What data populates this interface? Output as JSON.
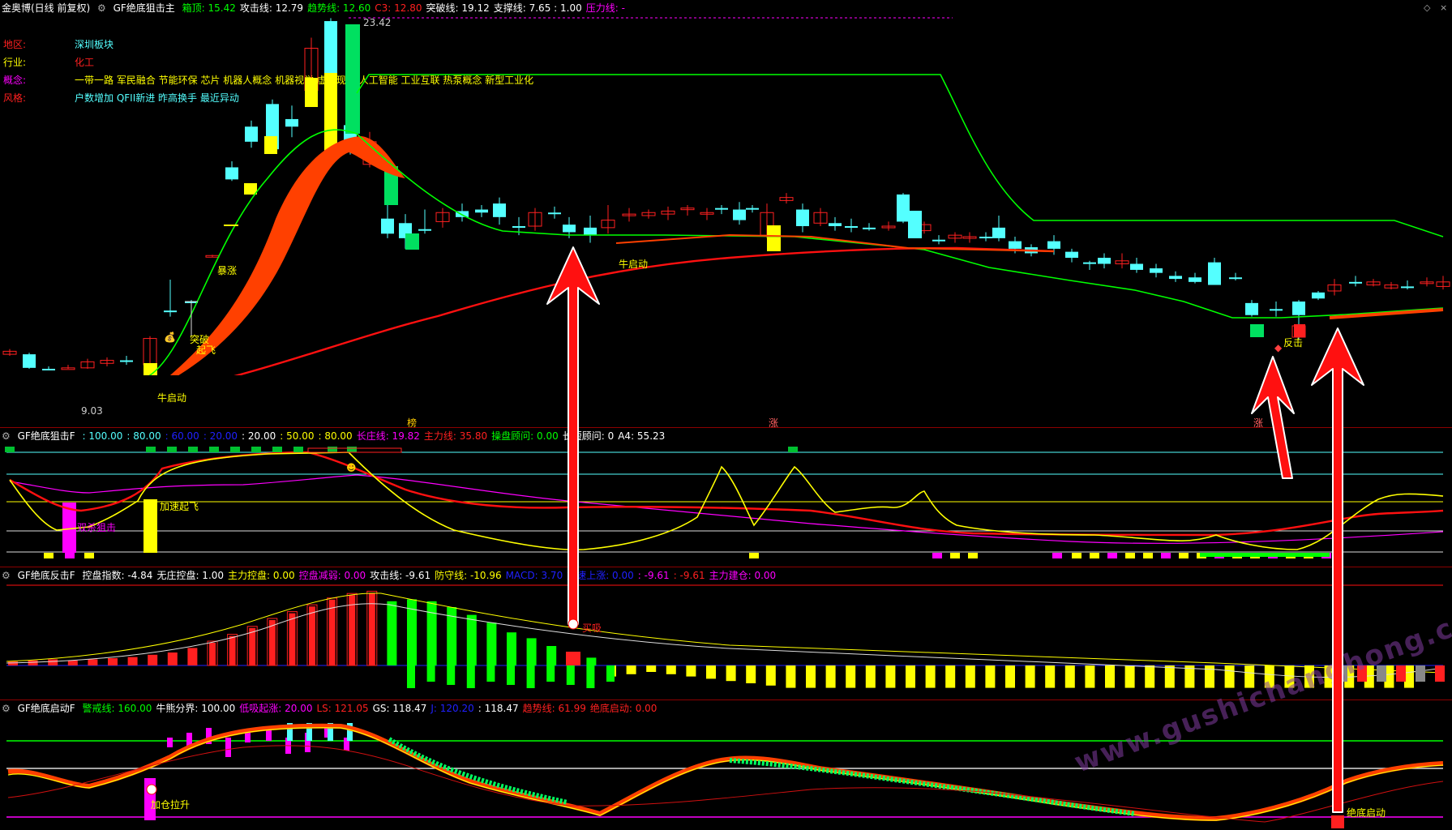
{
  "colors": {
    "red": "#ff2020",
    "green": "#00ff00",
    "cyan": "#54ffff",
    "yellow": "#ffff00",
    "magenta": "#ff00ff",
    "white": "#ffffff",
    "orange": "#ff4000"
  },
  "main": {
    "stock_name": "金奥博(日线 前复权)",
    "indicator": "GF绝底狙击主",
    "items": [
      {
        "label": "箱顶: 15.42",
        "color": "#00ff00"
      },
      {
        "label": "攻击线: 12.79",
        "color": "#ffffff"
      },
      {
        "label": "趋势线: 12.60",
        "color": "#00ff00"
      },
      {
        "label": "C3: 12.80",
        "color": "#ff2020"
      },
      {
        "label": "突破线: 19.12",
        "color": "#ffffff"
      },
      {
        "label": "支撑线: 7.65 : 1.00",
        "color": "#ffffff"
      },
      {
        "label": "压力线: -",
        "color": "#ff00ff"
      }
    ],
    "info": [
      {
        "key": "地区:",
        "key_color": "#ff2020",
        "value": "深圳板块",
        "value_color": "#54ffff"
      },
      {
        "key": "行业:",
        "key_color": "#ffff00",
        "value": "化工",
        "value_color": "#ff2020"
      },
      {
        "key": "概念:",
        "key_color": "#ff00ff",
        "value": "一带一路 军民融合 节能环保 芯片 机器人概念 机器视觉 虚拟现实 人工智能 工业互联 热泵概念 新型工业化",
        "value_color": "#ffff00"
      },
      {
        "key": "风格:",
        "key_color": "#ff2020",
        "value": "户数增加 QFII新进 昨高换手 最近异动",
        "value_color": "#54ffff"
      }
    ],
    "price_high": "23.42",
    "price_low": "9.03",
    "annotations": {
      "bull_start_1": "牛启动",
      "bull_start_2": "牛启动",
      "surge": "暴涨",
      "takeoff": "起飞",
      "breakout": "突破",
      "counter": "反击"
    },
    "markers": {
      "m1": "榜",
      "m2": "涨",
      "m3": "涨"
    }
  },
  "p2": {
    "indicator": "GF绝底狙击F",
    "items": [
      {
        "label": ": 100.00",
        "color": "#54ffff"
      },
      {
        "label": ": 80.00",
        "color": "#54ffff"
      },
      {
        "label": ": 60.00",
        "color": "#2020ff"
      },
      {
        "label": ": 20.00",
        "color": "#2020ff"
      },
      {
        "label": ": 20.00",
        "color": "#ffffff"
      },
      {
        "label": ": 50.00",
        "color": "#ffff00"
      },
      {
        "label": ": 80.00",
        "color": "#ffff00"
      },
      {
        "label": "长庄线: 19.82",
        "color": "#ff00ff"
      },
      {
        "label": "主力线: 35.80",
        "color": "#ff2020"
      },
      {
        "label": "操盘顾问: 0.00",
        "color": "#00ff00"
      },
      {
        "label": "长短顾问: 0",
        "color": "#ffffff"
      },
      {
        "label": "A4: 55.23",
        "color": "#ffffff"
      }
    ],
    "labels": {
      "double_kill": "双杀狙击",
      "accelerate": "加速起飞"
    }
  },
  "p3": {
    "indicator": "GF绝底反击F",
    "items": [
      {
        "label": "控盘指数: -4.84",
        "color": "#ffffff"
      },
      {
        "label": "无庄控盘: 1.00",
        "color": "#ffffff"
      },
      {
        "label": "主力控盘: 0.00",
        "color": "#ffff00"
      },
      {
        "label": "控盘减弱: 0.00",
        "color": "#ff00ff"
      },
      {
        "label": "攻击线: -9.61",
        "color": "#ffffff"
      },
      {
        "label": "防守线: -10.96",
        "color": "#ffff00"
      },
      {
        "label": "MACD: 3.70",
        "color": "#2020ff"
      },
      {
        "label": "加速上涨: 0.00",
        "color": "#2020ff"
      },
      {
        "label": ": -9.61",
        "color": "#ff00ff"
      },
      {
        "label": ": -9.61",
        "color": "#ff2020"
      },
      {
        "label": "主力建仓: 0.00",
        "color": "#ff00ff"
      }
    ],
    "label_buy": "买吸"
  },
  "p4": {
    "indicator": "GF绝底启动F",
    "items": [
      {
        "label": "警戒线: 160.00",
        "color": "#00ff00"
      },
      {
        "label": "牛熊分界: 100.00",
        "color": "#ffffff"
      },
      {
        "label": "低吸起涨: 20.00",
        "color": "#ff00ff"
      },
      {
        "label": "LS: 121.05",
        "color": "#ff2020"
      },
      {
        "label": "GS: 118.47",
        "color": "#ffffff"
      },
      {
        "label": "J: 120.20",
        "color": "#2020ff"
      },
      {
        "label": ": 118.47",
        "color": "#ffffff"
      },
      {
        "label": "趋势线: 61.99",
        "color": "#ff2020"
      },
      {
        "label": "绝底启动: 0.00",
        "color": "#ff2020"
      }
    ],
    "labels": {
      "add_pos": "加仓拉升",
      "bottom_start": "绝底启动"
    },
    "watermark": "www.gushichanghong.com"
  },
  "icons": [
    "gear-icon",
    "up-arrow-icon",
    "down-arrow-icon",
    "moneybag-icon",
    "gem-icon",
    "smiley-icon",
    "plus-circle-icon"
  ]
}
